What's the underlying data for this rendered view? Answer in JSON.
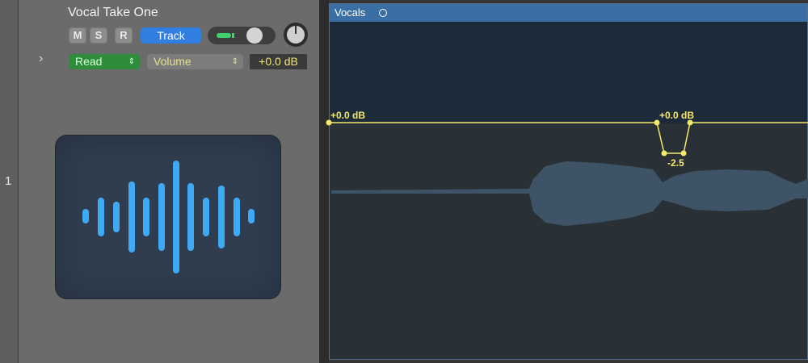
{
  "track": {
    "number": "1",
    "name": "Vocal Take One",
    "mute_label": "M",
    "solo_label": "S",
    "record_label": "R",
    "track_button_label": "Track",
    "automation_mode": "Read",
    "automation_parameter": "Volume",
    "automation_value": "+0.0 dB"
  },
  "region": {
    "name": "Vocals",
    "automation_start_label": "+0.0 dB",
    "automation_peak_label": "+0.0 dB",
    "automation_dip_label": "-2.5"
  },
  "icons": {
    "disclosure": "chevron-right-icon",
    "track_icon": "waveform-icon",
    "loop": "loop-circle-icon"
  },
  "colors": {
    "accent_blue": "#2f7ee0",
    "read_green": "#2f8c3a",
    "automation_yellow": "#f6ea6a",
    "region_header": "#3a6ea5",
    "waveform": "#3e5466"
  }
}
